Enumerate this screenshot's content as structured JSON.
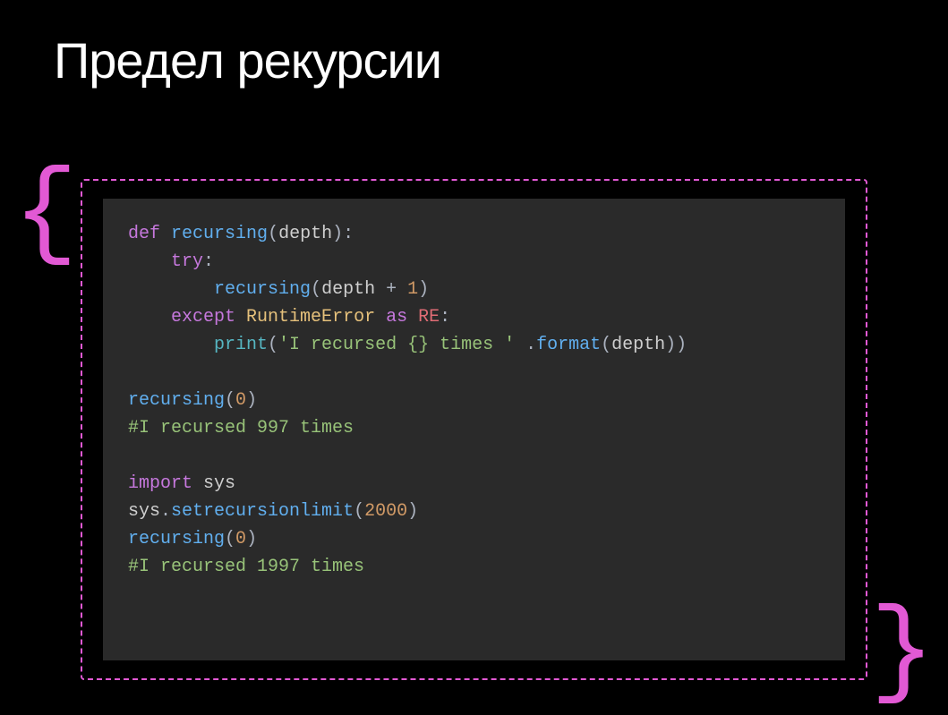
{
  "title": "Предел рекурсии",
  "braces": {
    "left": "{",
    "right": "}"
  },
  "code": {
    "l1": {
      "kw": "def",
      "fn": "recursing",
      "p1": "(",
      "arg": "depth",
      "p2": "):"
    },
    "l2": {
      "kw": "try",
      "p": ":"
    },
    "l3": {
      "fn": "recursing",
      "p1": "(",
      "arg": "depth",
      "op": " + ",
      "num": "1",
      "p2": ")"
    },
    "l4": {
      "kw1": "except",
      "type": "RuntimeError",
      "kw2": "as",
      "var": "RE",
      "p": ":"
    },
    "l5": {
      "call": "print",
      "p1": "(",
      "str": "'I recursed {} times '",
      "sp": " ",
      "p2": ".",
      "fmt": "format",
      "p3": "(",
      "arg": "depth",
      "p4": "))"
    },
    "l6": {
      "fn": "recursing",
      "p1": "(",
      "num": "0",
      "p2": ")"
    },
    "l7": {
      "comment": "#I recursed 997 times"
    },
    "l8": {
      "kw": "import",
      "mod": "sys"
    },
    "l9": {
      "obj": "sys",
      "p1": ".",
      "fn": "setrecursionlimit",
      "p2": "(",
      "num": "2000",
      "p3": ")"
    },
    "l10": {
      "fn": "recursing",
      "p1": "(",
      "num": "0",
      "p2": ")"
    },
    "l11": {
      "comment": "#I recursed 1997 times"
    }
  }
}
